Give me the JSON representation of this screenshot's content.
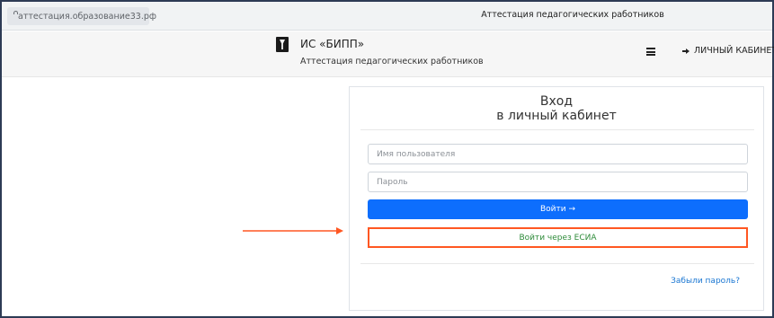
{
  "browser": {
    "url": "аттестация.образование33.рф",
    "tab_title": "Аттестация педагогических работников"
  },
  "header": {
    "title": "ИС «БИПП»",
    "subtitle": "Аттестация педагогических работников",
    "cabinet_label": "ЛИЧНЫЙ КАБИНЕТ"
  },
  "login": {
    "title_line1": "Вход",
    "title_line2": "в личный кабинет",
    "username_placeholder": "Имя пользователя",
    "password_placeholder": "Пароль",
    "login_button": "Войти →",
    "esia_button": "Войти через ЕСИА",
    "forgot_link": "Забыли пароль?"
  },
  "icons": [
    "lock-icon",
    "logo-icon",
    "menu-icon",
    "login-arrow-icon",
    "annotation-arrow-icon"
  ],
  "colors": {
    "primary": "#0d6efd",
    "highlight": "#ff5722",
    "esia_text": "#2e8b3a",
    "link": "#1976d2"
  }
}
